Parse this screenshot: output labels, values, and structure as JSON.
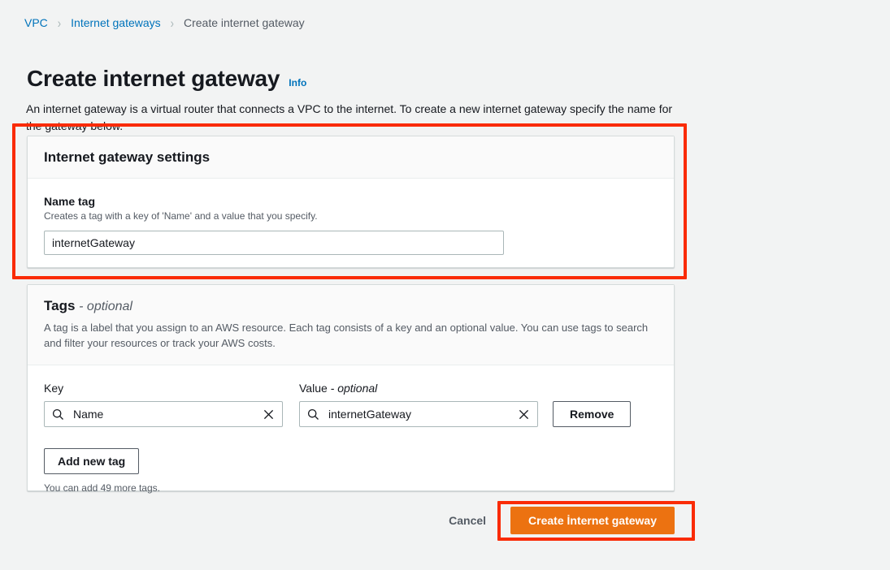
{
  "breadcrumb": {
    "items": [
      {
        "label": "VPC",
        "current": false
      },
      {
        "label": "Internet gateways",
        "current": false
      },
      {
        "label": "Create internet gateway",
        "current": true
      }
    ],
    "separator": "›"
  },
  "header": {
    "title": "Create internet gateway",
    "info_label": "Info",
    "description": "An internet gateway is a virtual router that connects a VPC to the internet. To create a new internet gateway specify the name for the gateway below."
  },
  "settings_card": {
    "title": "Internet gateway settings",
    "name_tag": {
      "label": "Name tag",
      "hint": "Creates a tag with a key of 'Name' and a value that you specify.",
      "value": "internetGateway",
      "placeholder": ""
    }
  },
  "tags_card": {
    "title": "Tags",
    "title_optional": "- optional",
    "description": "A tag is a label that you assign to an AWS resource. Each tag consists of a key and an optional value. You can use tags to search and filter your resources or track your AWS costs.",
    "columns": {
      "key_label": "Key",
      "value_label": "Value",
      "value_optional": "- optional"
    },
    "rows": [
      {
        "key": "Name",
        "key_placeholder": "",
        "value": "internetGateway",
        "value_placeholder": "",
        "remove_label": "Remove"
      }
    ],
    "add_tag_label": "Add new tag",
    "remaining_note": "You can add 49 more tags."
  },
  "actions": {
    "cancel_label": "Cancel",
    "create_label": "Create İnternet gateway"
  },
  "icons": {
    "search": "search-icon",
    "clear": "close-icon"
  },
  "colors": {
    "page_background": "#f2f3f3",
    "card_background": "#ffffff",
    "card_header_background": "#fafafa",
    "link_blue": "#0073bb",
    "primary_orange": "#ec7211",
    "annotation_red": "#fa2b06",
    "text_primary": "#16191f",
    "text_secondary": "#545b64",
    "border": "#aab7b8"
  }
}
